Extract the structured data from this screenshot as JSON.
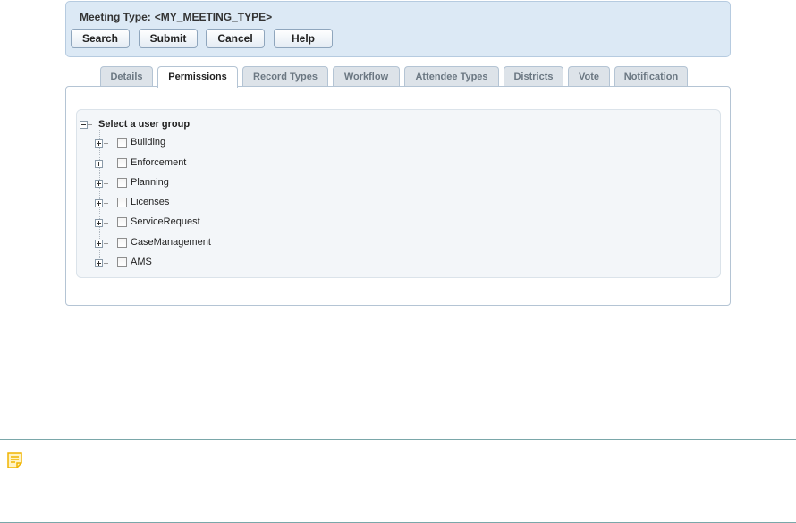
{
  "header": {
    "title_label": "Meeting Type:",
    "title_value": "<MY_MEETING_TYPE>",
    "buttons": {
      "search": "Search",
      "submit": "Submit",
      "cancel": "Cancel",
      "help": "Help"
    }
  },
  "tabs": [
    {
      "label": "Details",
      "active": false
    },
    {
      "label": "Permissions",
      "active": true
    },
    {
      "label": "Record Types",
      "active": false
    },
    {
      "label": "Workflow",
      "active": false
    },
    {
      "label": "Attendee Types",
      "active": false
    },
    {
      "label": "Districts",
      "active": false
    },
    {
      "label": "Vote",
      "active": false
    },
    {
      "label": "Notification",
      "active": false
    }
  ],
  "tree": {
    "root_label": "Select a user group",
    "items": [
      {
        "label": "Building",
        "checked": false
      },
      {
        "label": "Enforcement",
        "checked": false
      },
      {
        "label": "Planning",
        "checked": false
      },
      {
        "label": "Licenses",
        "checked": false
      },
      {
        "label": "ServiceRequest",
        "checked": false
      },
      {
        "label": "CaseManagement",
        "checked": false
      },
      {
        "label": "AMS",
        "checked": false
      }
    ]
  },
  "note": {
    "icon": "note-icon"
  },
  "colors": {
    "header_bg": "#dce9f5",
    "tab_inactive_bg": "#dde3e9",
    "note_icon": "#f0b400",
    "note_border": "#7aa7a9"
  }
}
